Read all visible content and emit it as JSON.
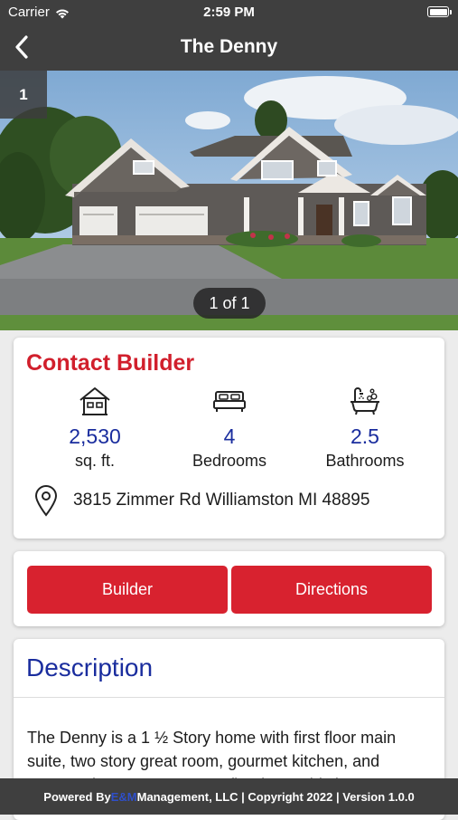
{
  "status_bar": {
    "carrier": "Carrier",
    "time": "2:59 PM"
  },
  "nav": {
    "title": "The Denny"
  },
  "gallery": {
    "index_badge": "1",
    "counter": "1 of 1"
  },
  "contact_card": {
    "heading": "Contact Builder",
    "stats": [
      {
        "icon": "house-icon",
        "value": "2,530",
        "label": "sq. ft."
      },
      {
        "icon": "bed-icon",
        "value": "4",
        "label": "Bedrooms"
      },
      {
        "icon": "bathtub-icon",
        "value": "2.5",
        "label": "Bathrooms"
      }
    ],
    "address": "3815 Zimmer Rd Williamston MI 48895"
  },
  "actions": {
    "builder_label": "Builder",
    "directions_label": "Directions"
  },
  "description": {
    "heading": "Description",
    "text": "The Denny is a 1 ½ Story home with first floor main suite, two story great room, gourmet kitchen, and spectacular two-story stone fireplace. This home"
  },
  "footer": {
    "prefix": "Powered By ",
    "accent": "E&M",
    "suffix": " Management, LLC | Copyright 2022 | Version 1.0.0"
  },
  "colors": {
    "bar": "#3f3f3f",
    "accent_red": "#d8222f",
    "accent_blue": "#1a2d9e"
  }
}
